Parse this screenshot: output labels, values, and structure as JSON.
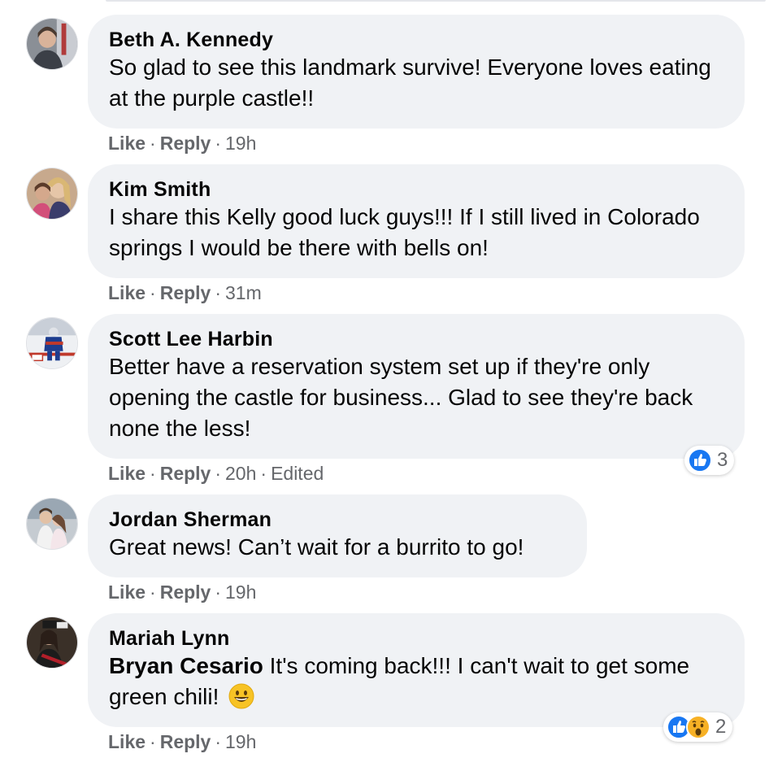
{
  "colors": {
    "like_blue": "#1877f2",
    "bubble": "#f0f2f5",
    "meta_gray": "#65676b",
    "wow_yellow": "#f7b125"
  },
  "actions": {
    "like": "Like",
    "reply": "Reply",
    "dot": "·"
  },
  "comments": [
    {
      "author": "Beth A. Kennedy",
      "text": "So glad to see this landmark survive! Everyone loves eating at the purple castle!!",
      "time": "19h"
    },
    {
      "author": "Kim Smith",
      "text": "I share this Kelly good luck guys!!! If I still lived in Colorado springs I would be there with bells on!",
      "time": "31m"
    },
    {
      "author": "Scott Lee Harbin",
      "text": "Better have a reservation system set up if they're only opening the castle for business... Glad to see they're back none the less!",
      "time": "20h",
      "edited": "Edited",
      "reaction_count": "3",
      "reaction_icons": [
        "like-icon"
      ]
    },
    {
      "author": "Jordan Sherman",
      "text": "Great news! Can’t wait for a burrito to go!",
      "time": "19h"
    },
    {
      "author": "Mariah Lynn",
      "mention": "Bryan Cesario",
      "text": " It's coming back!!! I can't wait to get some green chili!",
      "emoji": "grinning-face-emoji",
      "time": "19h",
      "reaction_count": "2",
      "reaction_icons": [
        "like-icon",
        "wow-icon"
      ]
    }
  ]
}
